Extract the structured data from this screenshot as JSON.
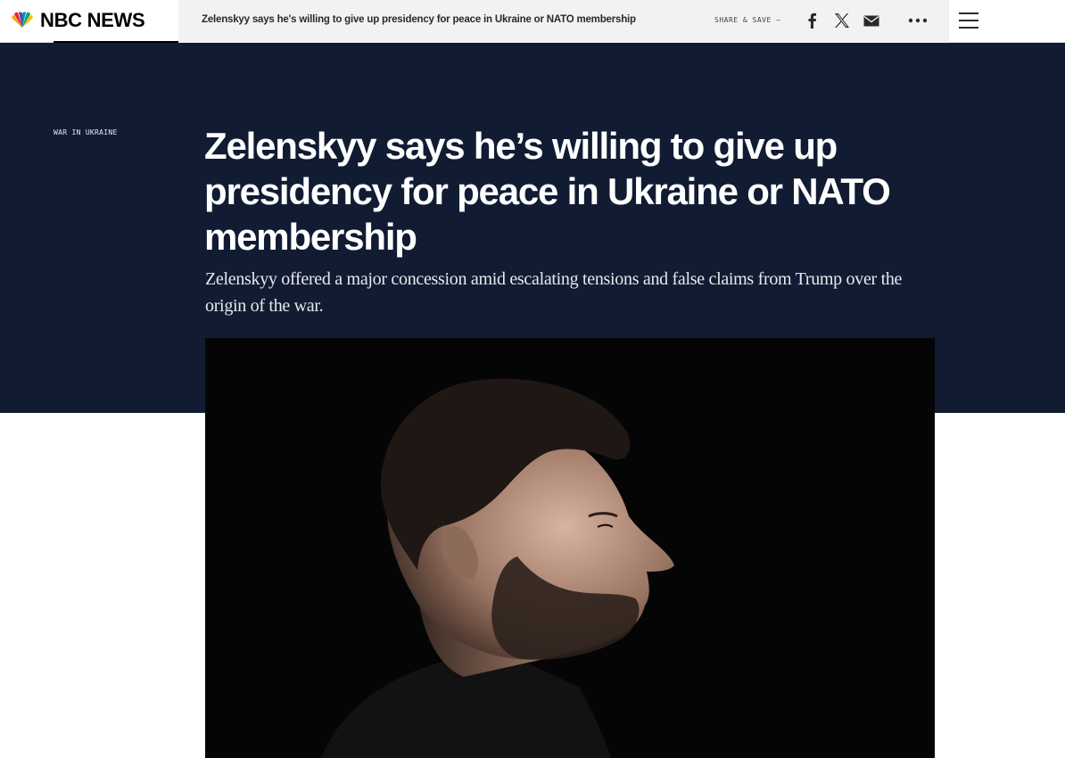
{
  "header": {
    "logo_text": "NBC NEWS",
    "sticky_headline": "Zelenskyy says he's willing to give up presidency for peace in Ukraine or NATO membership",
    "share_label": "SHARE & SAVE —",
    "icons": [
      "facebook-icon",
      "x-icon",
      "email-icon",
      "more-icon",
      "menu-icon"
    ]
  },
  "article": {
    "eyebrow": "WAR IN UKRAINE",
    "headline": "Zelenskyy says he’s willing to give up presidency for peace in Ukraine or NATO membership",
    "dek": "Zelenskyy offered a major concession amid escalating tensions and false claims from Trump over the origin of the war."
  },
  "colors": {
    "hero_background": "#111c33",
    "image_background": "#060606",
    "peacock": [
      "#f6a01a",
      "#e7232f",
      "#6b3fa0",
      "#0089cf",
      "#00a650",
      "#fcb711"
    ]
  }
}
